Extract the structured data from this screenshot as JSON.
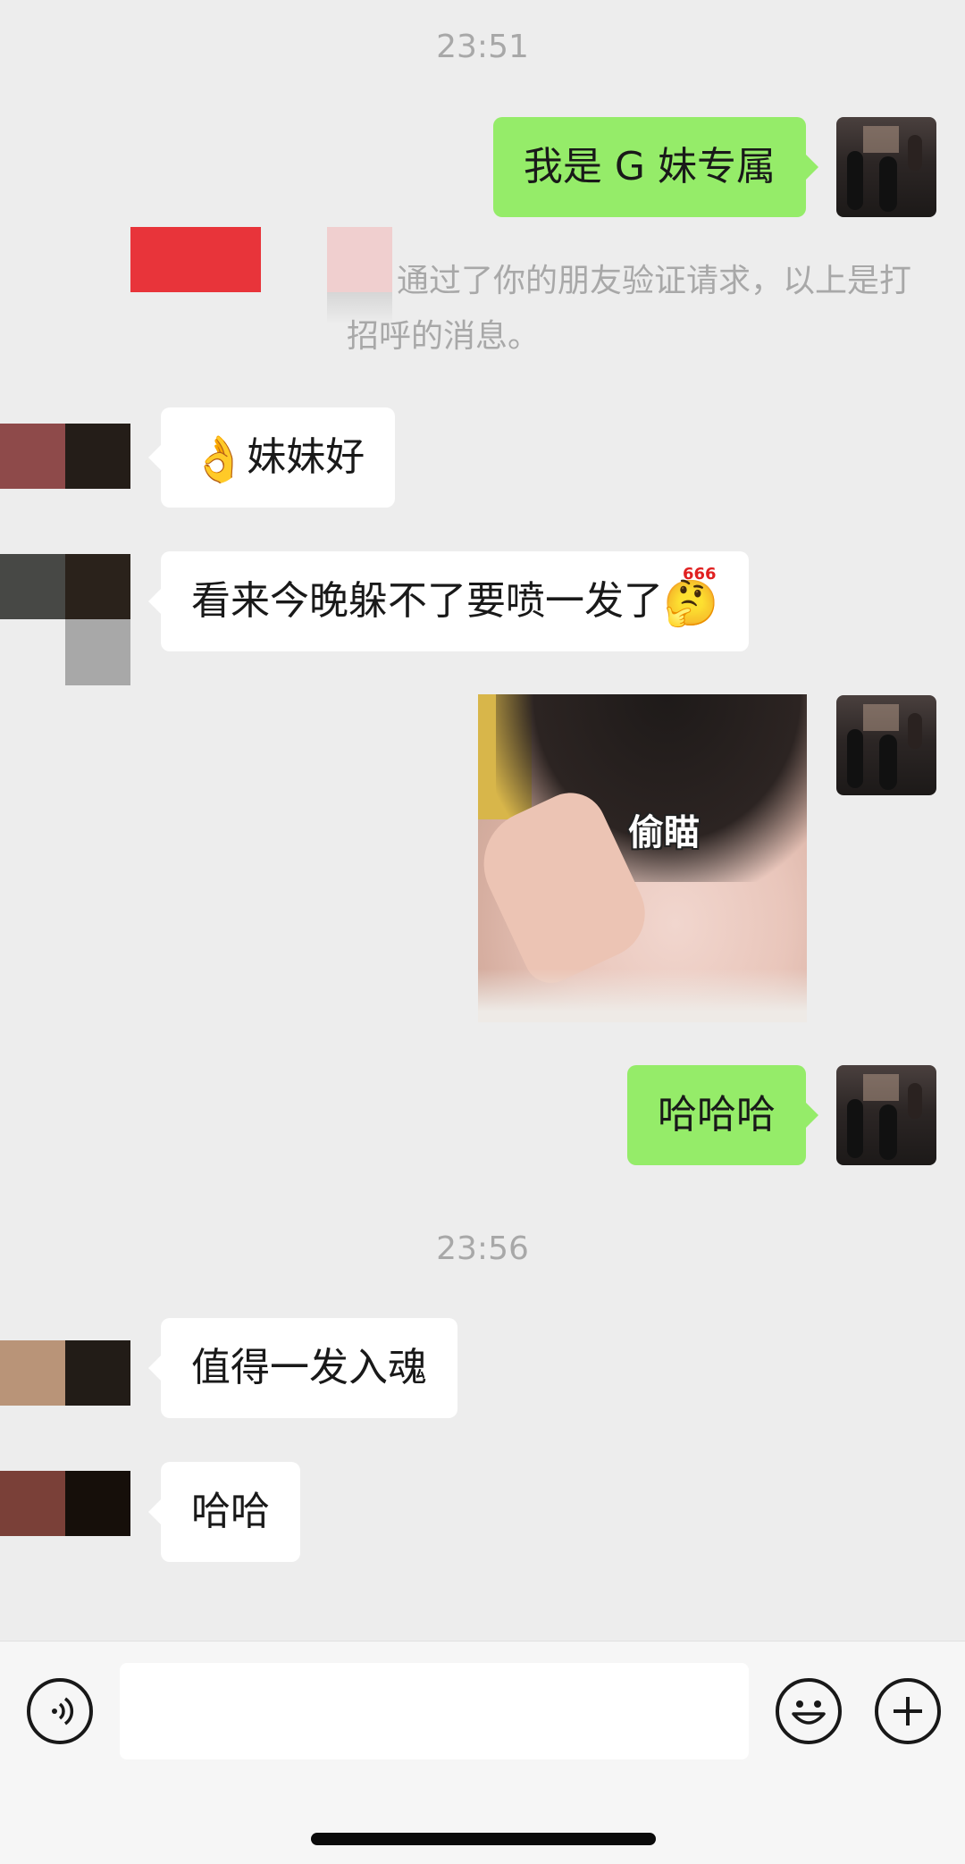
{
  "chat": {
    "timestamps": [
      "23:51",
      "23:56"
    ],
    "system_message": "通过了你的朋友验证请求，以上是打招呼的消息。",
    "messages": [
      {
        "sender": "me",
        "text": "我是 G 妹专属"
      },
      {
        "sender": "friend",
        "emoji": "👌",
        "text": "妹妹好"
      },
      {
        "sender": "friend",
        "text": "看来今晚躲不了要喷一发了",
        "emoji_trailing": "🤔"
      },
      {
        "sender": "me",
        "sticker_caption": "偷瞄"
      },
      {
        "sender": "me",
        "text": "哈哈哈"
      },
      {
        "sender": "friend",
        "text": "值得一发入魂"
      },
      {
        "sender": "friend",
        "text": "哈哈"
      }
    ]
  },
  "emoji_666_label": "666",
  "input_bar": {
    "placeholder": "",
    "voice_icon": "voice-icon",
    "emoji_icon": "emoji-icon",
    "plus_icon": "plus-icon"
  },
  "colors": {
    "my_bubble": "#95ec69",
    "friend_bubble": "#ffffff",
    "background": "#ededed",
    "timestamp": "#a8a8a8"
  }
}
